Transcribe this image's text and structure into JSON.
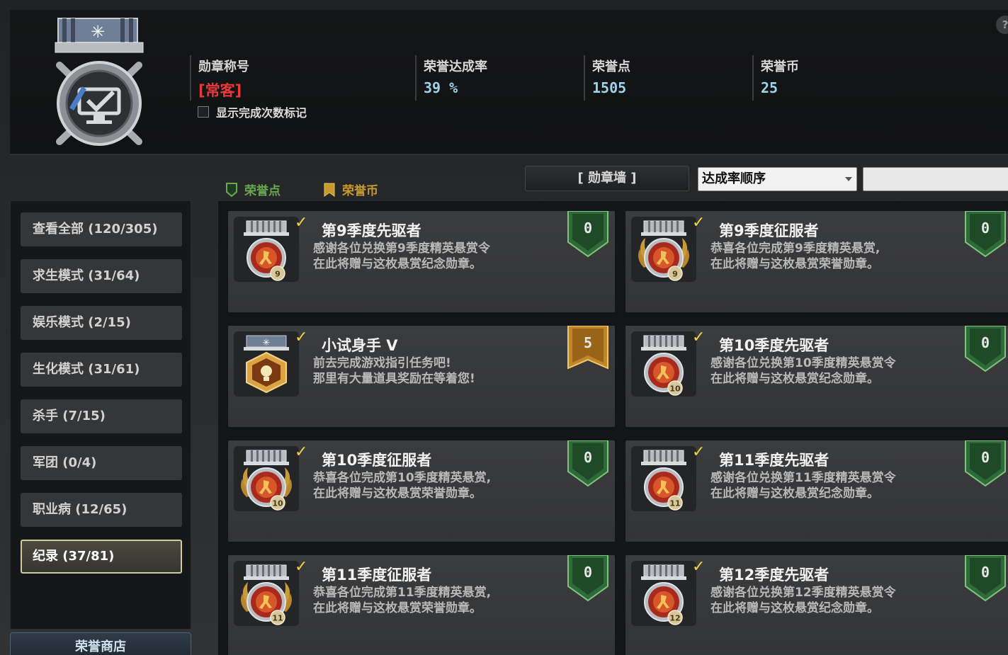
{
  "header": {
    "title_label": "勋章称号",
    "title_value": "[常客]",
    "rate_label": "荣誉达成率",
    "rate_value": "39 %",
    "points_label": "荣誉点",
    "points_value": "1505",
    "coins_label": "荣誉币",
    "coins_value": "25",
    "checkbox_label": "显示完成次数标记",
    "checkbox_checked": false,
    "help_icon": "?"
  },
  "legend": {
    "points_label": "荣誉点",
    "points_color": "#6aa84f",
    "coins_label": "荣誉币",
    "coins_color": "#c99a2e"
  },
  "toolbar": {
    "wall_button": "[ 勋章墙 ]",
    "sort_value": "达成率顺序",
    "search_value": ""
  },
  "sidebar": {
    "items": [
      {
        "label": "查看全部 (120/305)",
        "active": false
      },
      {
        "label": "求生模式 (31/64)",
        "active": false
      },
      {
        "label": "娱乐模式 (2/15)",
        "active": false
      },
      {
        "label": "生化模式 (31/61)",
        "active": false
      },
      {
        "label": "杀手 (7/15)",
        "active": false
      },
      {
        "label": "军团 (0/4)",
        "active": false
      },
      {
        "label": "职业病 (12/65)",
        "active": false
      },
      {
        "label": "纪录 (37/81)",
        "active": true
      }
    ],
    "shop_tab": "荣誉商店"
  },
  "medals": [
    {
      "title": "第9季度先驱者",
      "desc": "感谢各位兑换第9季度精英悬赏令\n在此将赠与这枚悬赏纪念勋章。",
      "reward": "0",
      "reward_type": "points",
      "kind": "pioneer",
      "season": "9",
      "completed": true
    },
    {
      "title": "第9季度征服者",
      "desc": "恭喜各位完成第9季度精英悬赏,\n在此将赠与这枚悬赏荣誉勋章。",
      "reward": "0",
      "reward_type": "points",
      "kind": "conqueror",
      "season": "9",
      "completed": true
    },
    {
      "title": "小试身手 V",
      "desc": "前去完成游戏指引任务吧!\n那里有大量道具奖励在等着您!",
      "reward": "5",
      "reward_type": "coins",
      "kind": "tutorial",
      "season": "",
      "completed": true
    },
    {
      "title": "第10季度先驱者",
      "desc": "感谢各位兑换第10季度精英悬赏令\n在此将赠与这枚悬赏纪念勋章。",
      "reward": "0",
      "reward_type": "points",
      "kind": "pioneer",
      "season": "10",
      "completed": true
    },
    {
      "title": "第10季度征服者",
      "desc": "恭喜各位完成第10季度精英悬赏,\n在此将赠与这枚悬赏荣誉勋章。",
      "reward": "0",
      "reward_type": "points",
      "kind": "conqueror",
      "season": "10",
      "completed": true
    },
    {
      "title": "第11季度先驱者",
      "desc": "感谢各位兑换第11季度精英悬赏令\n在此将赠与这枚悬赏纪念勋章。",
      "reward": "0",
      "reward_type": "points",
      "kind": "pioneer",
      "season": "11",
      "completed": true
    },
    {
      "title": "第11季度征服者",
      "desc": "恭喜各位完成第11季度精英悬赏,\n在此将赠与这枚悬赏荣誉勋章。",
      "reward": "0",
      "reward_type": "points",
      "kind": "conqueror",
      "season": "11",
      "completed": true
    },
    {
      "title": "第12季度先驱者",
      "desc": "感谢各位兑换第12季度精英悬赏令\n在此将赠与这枚悬赏纪念勋章。",
      "reward": "0",
      "reward_type": "points",
      "kind": "pioneer",
      "season": "12",
      "completed": true
    }
  ],
  "icons": {
    "check": "✓",
    "main_medal": "computer-medal-icon",
    "pioneer": "pioneer-medal-icon",
    "conqueror": "conqueror-medal-icon",
    "tutorial": "tutorial-medal-icon"
  }
}
